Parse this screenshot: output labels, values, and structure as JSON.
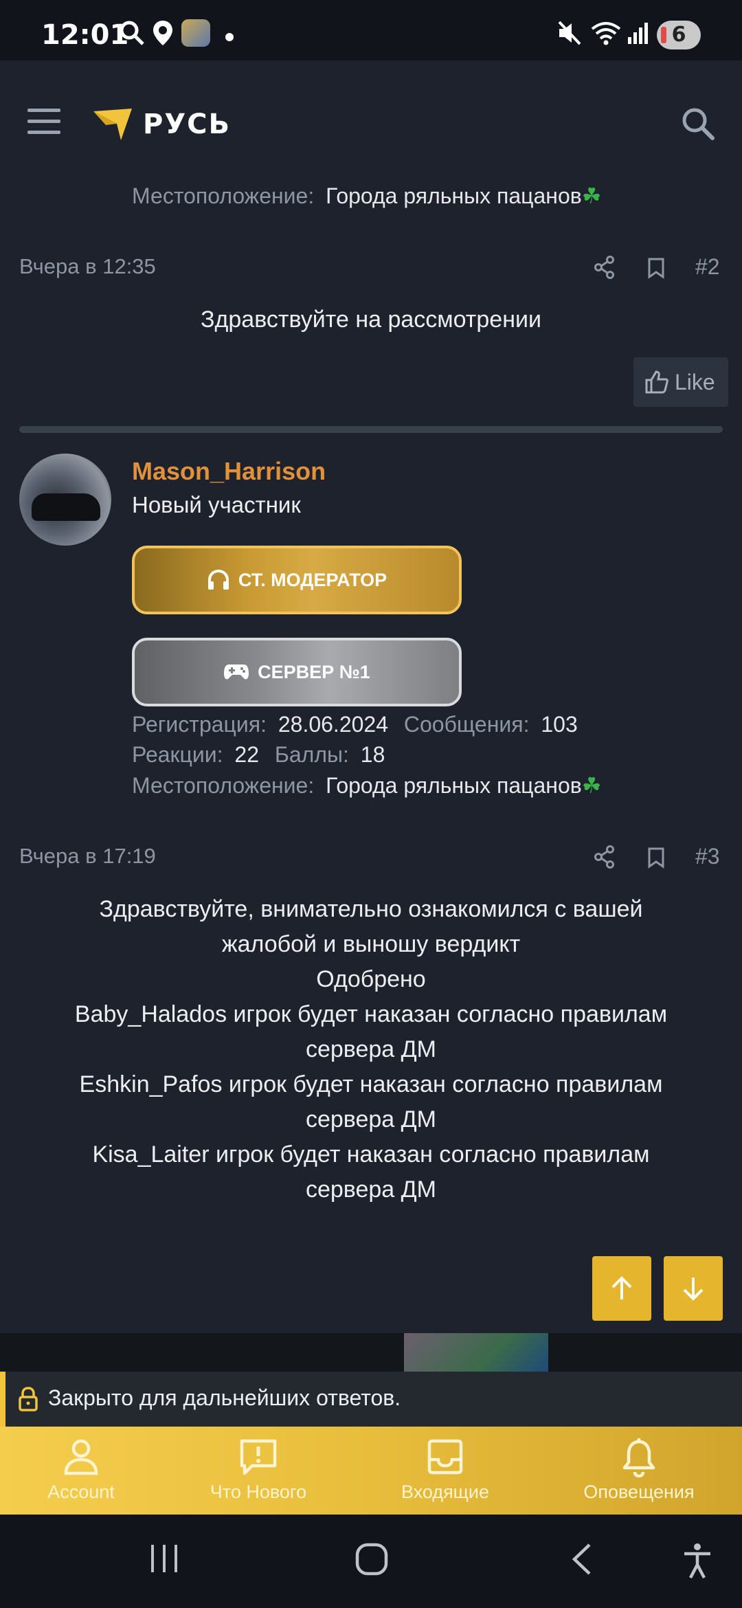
{
  "status_bar": {
    "time": "12:01",
    "notifications_count": "6"
  },
  "header": {
    "logo_text": "РУСЬ"
  },
  "top_location": {
    "label": "Местоположение:",
    "value": "Города ряльных пацанов",
    "emoji": "☘"
  },
  "post2": {
    "date": "Вчера в 12:35",
    "number": "#2",
    "text": "Здравствуйте на рассмотрении",
    "like_label": "Like"
  },
  "author": {
    "username": "Mason_Harrison",
    "title": "Новый участник",
    "badge1": "СТ. МОДЕРАТОР",
    "badge2": "СЕРВЕР №1",
    "stats": {
      "reg_label": "Регистрация:",
      "reg_value": "28.06.2024",
      "msg_label": "Сообщения:",
      "msg_value": "103",
      "react_label": "Реакции:",
      "react_value": "22",
      "points_label": "Баллы:",
      "points_value": "18",
      "loc_label": "Местоположение:",
      "loc_value": "Города ряльных пацанов",
      "loc_emoji": "☘"
    }
  },
  "post3": {
    "date": "Вчера в 17:19",
    "number": "#3",
    "lines": [
      "Здравствуйте, внимательно ознакомился с вашей",
      "жалобой и выношу вердикт",
      "Одобрено",
      "Baby_Halados игрок будет наказан согласно правилам",
      "сервера ДМ",
      "Eshkin_Pafos игрок будет наказан согласно правилам",
      "сервера ДМ",
      "Kisa_Laiter игрок будет наказан согласно правилам",
      "сервера ДМ"
    ]
  },
  "closed_notice": "Закрыто для дальнейших ответов.",
  "bottom_nav": [
    {
      "label": "Account",
      "icon": "user-icon"
    },
    {
      "label": "Что Нового",
      "icon": "news-icon"
    },
    {
      "label": "Входящие",
      "icon": "inbox-icon"
    },
    {
      "label": "Оповещения",
      "icon": "bell-icon"
    }
  ],
  "colors": {
    "accent": "#f2c43d",
    "username": "#e0913a",
    "background": "#1d222c"
  }
}
